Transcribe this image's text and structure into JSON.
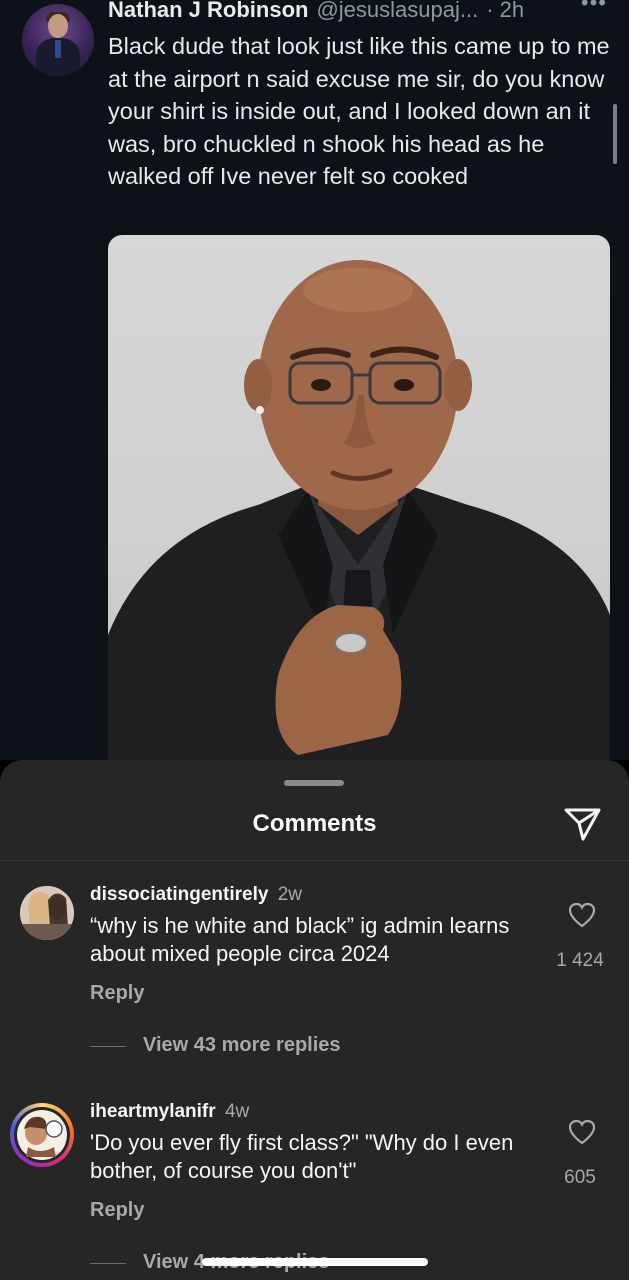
{
  "post": {
    "author_name": "Nathan J Robinson",
    "author_handle": "@jesuslasupaj...",
    "time": "· 2h",
    "more": "•••",
    "text": "Black dude that look just like this came up to me at the airport n said excuse me sir, do you know your shirt is inside out, and I looked down an it was, bro chuckled n shook his head as he walked off Ive never felt so cooked"
  },
  "sheet": {
    "title": "Comments"
  },
  "comments": [
    {
      "username": "dissociatingentirely",
      "time": "2w",
      "text": "“why is he white and black” ig admin learns about mixed people circa 2024",
      "likes": "1 424",
      "reply_label": "Reply",
      "view_replies": "View 43 more replies"
    },
    {
      "username": "iheartmylanifr",
      "time": "4w",
      "text": "'Do you ever fly first class?\" \"Why do I even bother, of course you don't\"",
      "likes": "605",
      "reply_label": "Reply",
      "view_replies": "View 4 more replies"
    }
  ],
  "colors": {
    "post_bg": "#0d1219",
    "sheet_bg": "#262626",
    "secondary_text": "#a8a8a8",
    "story_ring": "#d6249f"
  },
  "icons": {
    "send": "paper-plane-icon",
    "like": "heart-outline-icon"
  }
}
